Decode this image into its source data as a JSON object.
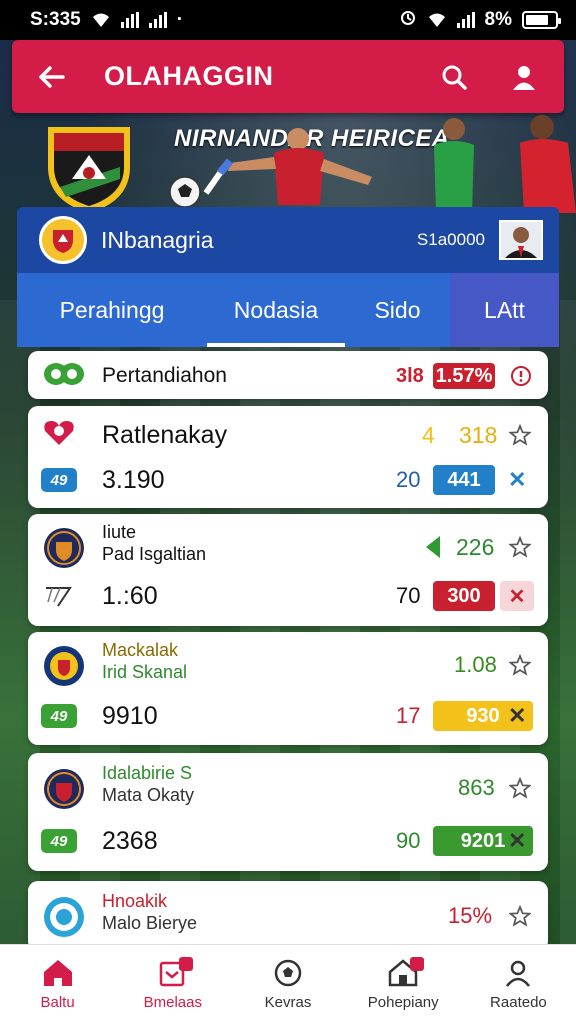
{
  "status": {
    "time": "S:335",
    "signal_text": "·",
    "battery": "8%"
  },
  "header": {
    "title": "OLAHAGGIN"
  },
  "banner": {
    "title": "NIRNANDAR HEIRICEA"
  },
  "card": {
    "name": "INbanagria",
    "amount": "S1a0000"
  },
  "tabs": [
    {
      "label": "Perahingg"
    },
    {
      "label": "Nodasia"
    },
    {
      "label": "Sido"
    },
    {
      "label": "LAtt"
    }
  ],
  "list": {
    "row1": {
      "name": "Pertandiahon",
      "num": "3l8",
      "pill": "1.57%"
    },
    "row2": {
      "name": "Ratlenakay",
      "num_a": "4",
      "num_b": "318",
      "sub_badge": "49",
      "sub_value": "3.190",
      "sub_num": "20",
      "sub_pill": "441"
    },
    "row3": {
      "name1": "Iiute",
      "name2": "Pad Isgaltian",
      "num": "226",
      "sub_value": "1.:60",
      "sub_num": "70",
      "sub_pill": "300"
    },
    "row4": {
      "name1": "Mackalak",
      "name2": "Irid Skanal",
      "num": "1.08",
      "sub_badge": "49",
      "sub_value": "9910",
      "sub_num": "17",
      "sub_pill": "930"
    },
    "row5": {
      "name1": "Idalabirie S",
      "name2": "Mata Okaty",
      "num": "863",
      "sub_badge": "49",
      "sub_value": "2368",
      "sub_num": "90",
      "sub_pill": "9201"
    },
    "row6": {
      "name1": "Hnoakik",
      "name2": "Malo Bierye",
      "num": "15%"
    }
  },
  "nav": [
    {
      "label": "Baltu"
    },
    {
      "label": "Bmelaas"
    },
    {
      "label": "Kevras"
    },
    {
      "label": "Pohepiany"
    },
    {
      "label": "Raatedo"
    }
  ],
  "colors": {
    "accent": "#d41c48",
    "primary": "#1d4aa6",
    "tab_bg": "#2c6ad1",
    "green": "#3a9a2f",
    "yellow": "#f2c21a",
    "blue_pill": "#2280c8"
  }
}
